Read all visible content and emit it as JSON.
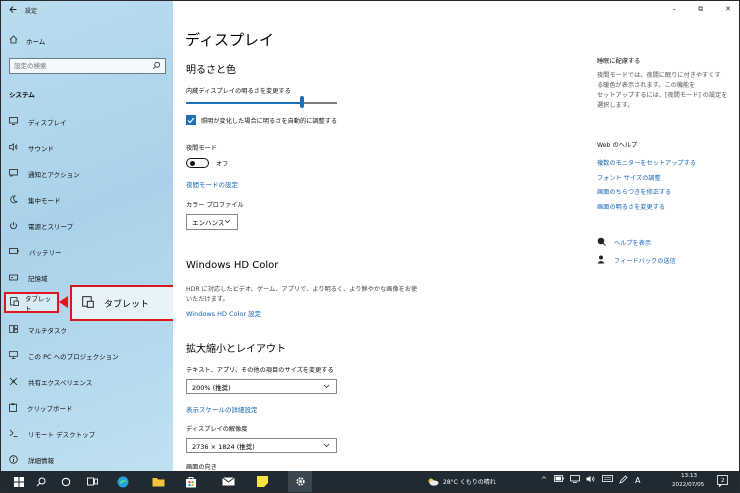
{
  "window": {
    "title": "設定",
    "minimize": "–",
    "maximize": "⧉",
    "close": "✕"
  },
  "sidebar": {
    "home": "ホーム",
    "search_placeholder": "設定の検索",
    "section": "システム",
    "items": [
      {
        "label": "ディスプレイ",
        "icon": "monitor-icon"
      },
      {
        "label": "サウンド",
        "icon": "speaker-icon"
      },
      {
        "label": "通知とアクション",
        "icon": "notification-icon"
      },
      {
        "label": "集中モード",
        "icon": "moon-icon"
      },
      {
        "label": "電源とスリープ",
        "icon": "power-icon"
      },
      {
        "label": "バッテリー",
        "icon": "battery-icon"
      },
      {
        "label": "記憶域",
        "icon": "storage-icon"
      },
      {
        "label": "タブレット",
        "icon": "tablet-icon"
      },
      {
        "label": "マルチタスク",
        "icon": "multitask-icon"
      },
      {
        "label": "この PC へのプロジェクション",
        "icon": "projection-icon"
      },
      {
        "label": "共有エクスペリエンス",
        "icon": "share-icon"
      },
      {
        "label": "クリップボード",
        "icon": "clipboard-icon"
      },
      {
        "label": "リモート デスクトップ",
        "icon": "remote-desktop-icon"
      },
      {
        "label": "詳細情報",
        "icon": "info-icon"
      }
    ],
    "active_index": 7
  },
  "callout": {
    "label": "タブレット"
  },
  "main": {
    "title": "ディスプレイ",
    "brightness_heading": "明るさと色",
    "brightness_label": "内蔵ディスプレイの明るさを変更する",
    "brightness_level": 0.77,
    "auto_brightness_label": "照明が変化した場合に明るさを自動的に調整する",
    "night_mode_label": "夜間モード",
    "night_mode_state": "オフ",
    "night_mode_settings_link": "夜間モードの設定",
    "color_profile_label": "カラー プロファイル",
    "color_profile_value": "エンハンス",
    "hd_color_heading": "Windows HD Color",
    "hd_color_desc_1": "HDR に対応したビデオ、ゲーム、アプリで、より明るく、より鮮やかな画像をお使",
    "hd_color_desc_2": "いただけます。",
    "hd_color_link": "Windows HD Color 設定",
    "scale_heading": "拡大縮小とレイアウト",
    "scale_label": "テキスト、アプリ、その他の項目のサイズを変更する",
    "scale_value": "200% (推奨)",
    "advanced_scale_link": "表示スケールの詳細設定",
    "resolution_label": "ディスプレイの解像度",
    "resolution_value": "2736 × 1824 (推奨)",
    "orientation_label": "画面の向き"
  },
  "right_panel": {
    "sleep_heading": "睡眠に配慮する",
    "sleep_desc": [
      "夜間モードでは、夜間に眠りに付きやすくす",
      "る暖色が表示されます。この機能を",
      "セットアップするには、[夜間モード] の設定を",
      "選択します。"
    ],
    "web_help_heading": "Web のヘルプ",
    "links": [
      "複数のモニターをセットアップする",
      "フォント サイズの調整",
      "画面のちらつきを修正する",
      "画面の明るさを変更する"
    ],
    "help_label": "ヘルプを表示",
    "feedback_label": "フィードバックの送信"
  },
  "taskbar": {
    "weather": "28°C くもりの晴れ",
    "ime": "A",
    "time": "13:13",
    "date": "2022/07/05",
    "notification_count": "2"
  }
}
